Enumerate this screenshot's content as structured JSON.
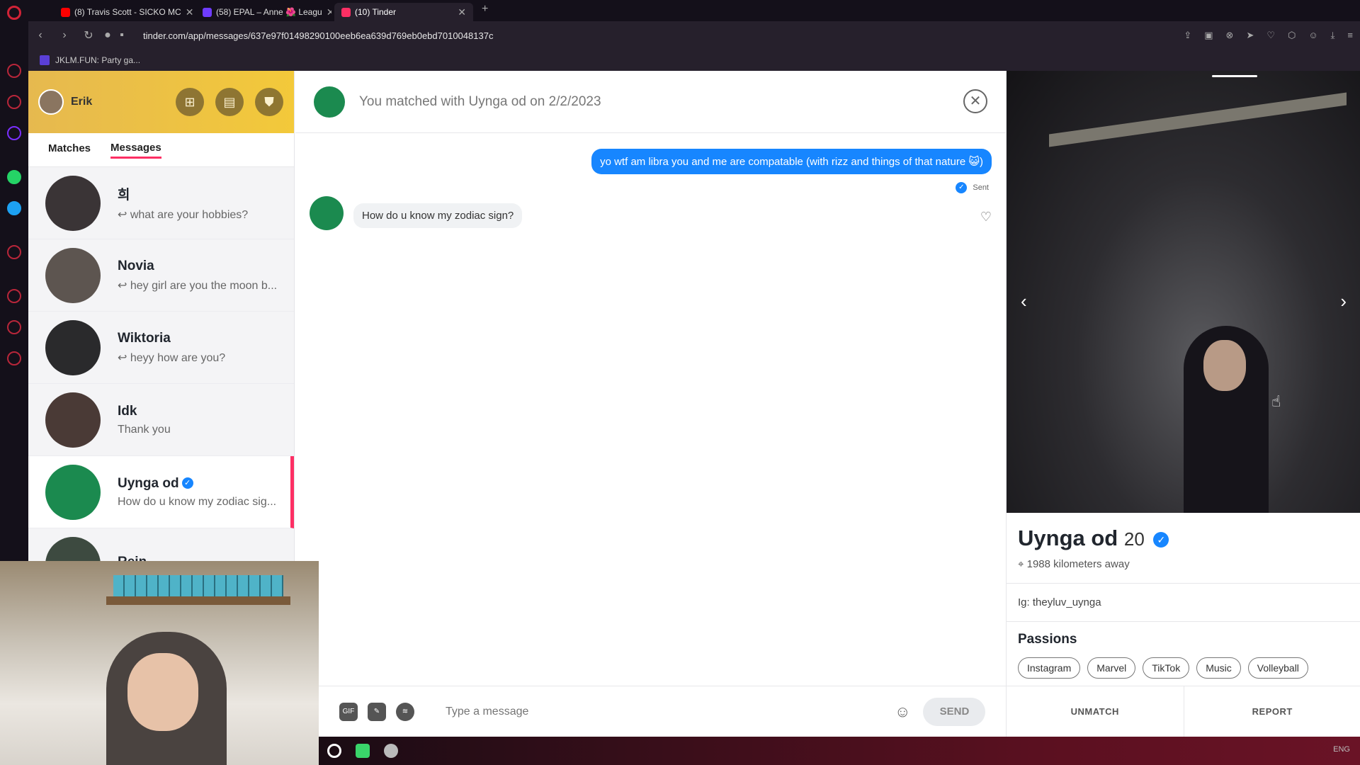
{
  "browser": {
    "tabs": [
      {
        "title": "(8) Travis Scott - SICKO MC",
        "color": "#ff0000"
      },
      {
        "title": "(58) EPAL – Anne 🌺 Leagu",
        "color": "#6f3cff"
      },
      {
        "title": "(10) Tinder",
        "color": "#fd2f64"
      }
    ],
    "url": "tinder.com/app/messages/637e97f01498290100eeb6ea639d769eb0ebd7010048137c",
    "bookmark": "JKLM.FUN: Party ga..."
  },
  "sidebar": {
    "user_name": "Erik",
    "tabs": {
      "matches": "Matches",
      "messages": "Messages"
    },
    "conversations": [
      {
        "name": "희",
        "msg": "↩ what are your hobbies?",
        "color": "#3a3436"
      },
      {
        "name": "Novia",
        "msg": "↩ hey girl are you the moon b...",
        "color": "#5d5550"
      },
      {
        "name": "Wiktoria",
        "msg": "↩ heyy how are you?",
        "color": "#2a2a2c"
      },
      {
        "name": "Idk",
        "msg": "Thank you",
        "color": "#4a3a36"
      },
      {
        "name": "Uynga od",
        "msg": "How do u know my zodiac sig...",
        "color": "#1b8a4f"
      },
      {
        "name": "Rein",
        "msg": "",
        "color": "#3d4a40"
      }
    ]
  },
  "chat": {
    "header": "You matched with Uynga od on 2/2/2023",
    "outgoing": "yo wtf am libra you and me are compatable (with rizz and things of that nature 😺)",
    "sent_label": "Sent",
    "incoming": "How do u know my zodiac sign?",
    "composer": {
      "placeholder": "Type a message",
      "gif": "GIF",
      "send": "SEND"
    }
  },
  "profile": {
    "name": "Uynga od",
    "age": "20",
    "distance": "1988 kilometers away",
    "bio": "Ig: theyluv_uynga",
    "passions_title": "Passions",
    "passions": [
      "Instagram",
      "Marvel",
      "TikTok",
      "Music",
      "Volleyball"
    ],
    "unmatch": "UNMATCH",
    "report": "REPORT"
  },
  "taskbar": {
    "lang": "ENG"
  }
}
